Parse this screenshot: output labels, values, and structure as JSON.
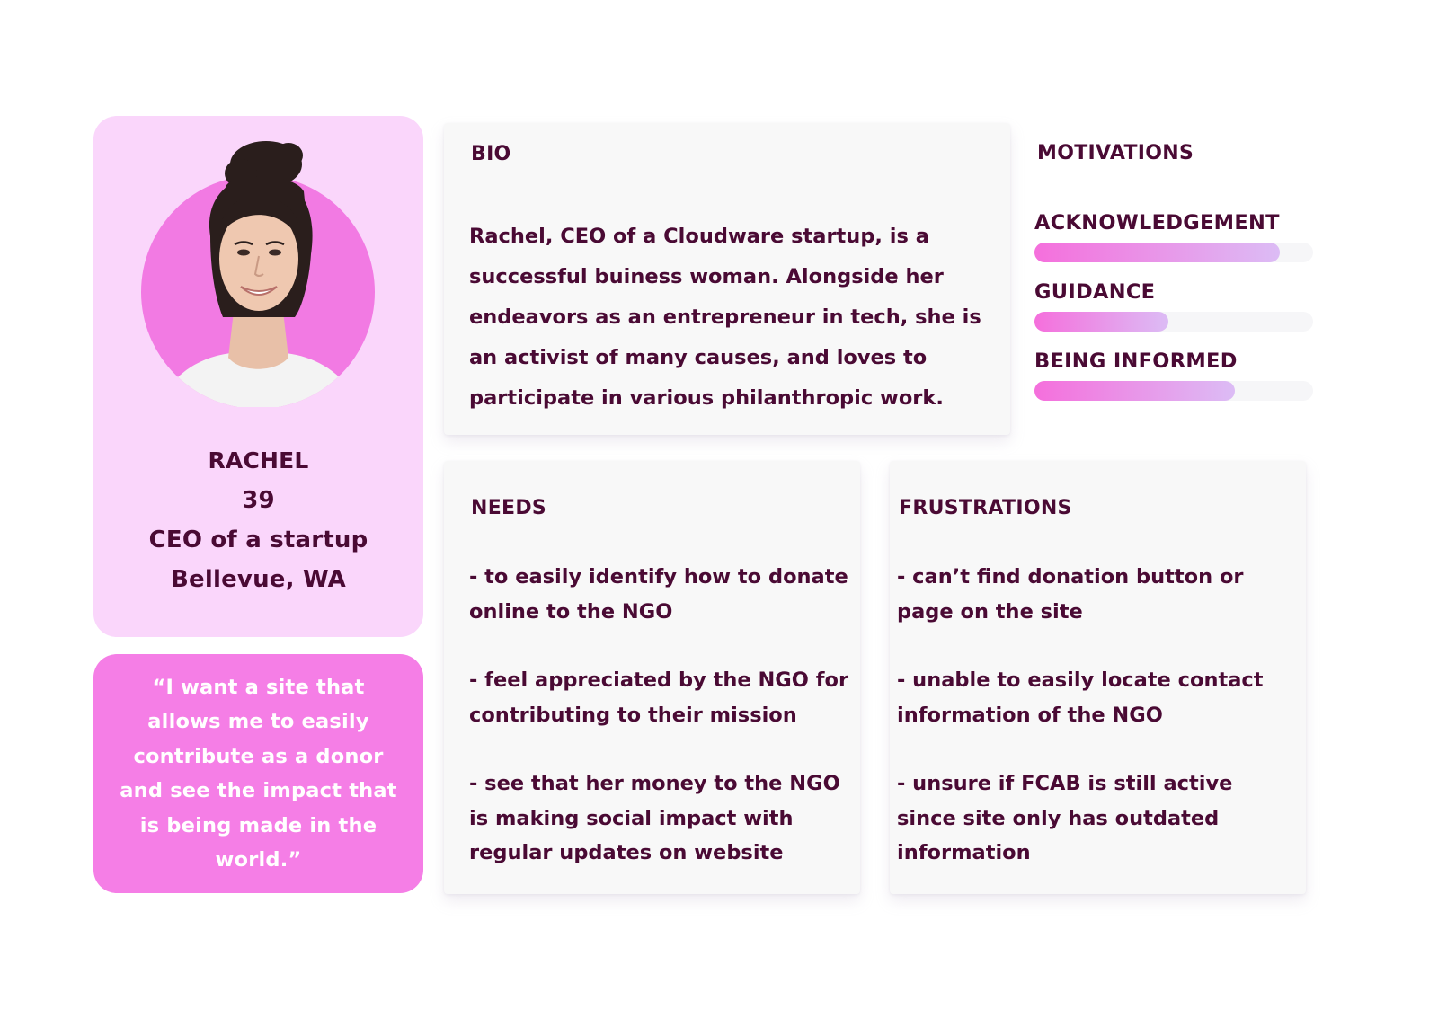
{
  "profile": {
    "name": "RACHEL",
    "age": "39",
    "role": "CEO of a startup",
    "location": "Bellevue, WA",
    "avatar_icon": "portrait-photo",
    "card_color": "#fad6fb",
    "avatar_bg_color": "#f27ae3"
  },
  "quote": {
    "text": "“I want a site that allows me to easily contribute as a donor and see the impact that is being made in the world.”",
    "color": "#f57ee6"
  },
  "bio": {
    "title": "BIO",
    "text": "Rachel, CEO of a Cloudware startup, is a successful buiness woman. Alongside her endeavors as an entrepreneur in tech, she is an activist of many causes, and loves to participate in various philanthropic work."
  },
  "motivations": {
    "title": "MOTIVATIONS",
    "items": [
      {
        "label": "ACKNOWLEDGEMENT",
        "level": 0.88
      },
      {
        "label": "GUIDANCE",
        "level": 0.48
      },
      {
        "label": "BEING INFORMED",
        "level": 0.72
      }
    ]
  },
  "needs": {
    "title": "NEEDS",
    "items": [
      "- to easily identify how to donate online to the NGO",
      "- feel appreciated by the NGO for contributing to their mission",
      "- see that her money to the NGO is making social impact with regular updates on website"
    ]
  },
  "frustrations": {
    "title": "FRUSTRATIONS",
    "items": [
      "- can’t find donation button or page on the site",
      "- unable to easily locate contact information of the NGO",
      "- unsure if FCAB is still active since site only has outdated information"
    ]
  },
  "colors": {
    "text": "#4a0a34",
    "bar_start": "#f56fdc",
    "bar_end": "#dcbcf5",
    "panel": "#f8f8f8"
  }
}
